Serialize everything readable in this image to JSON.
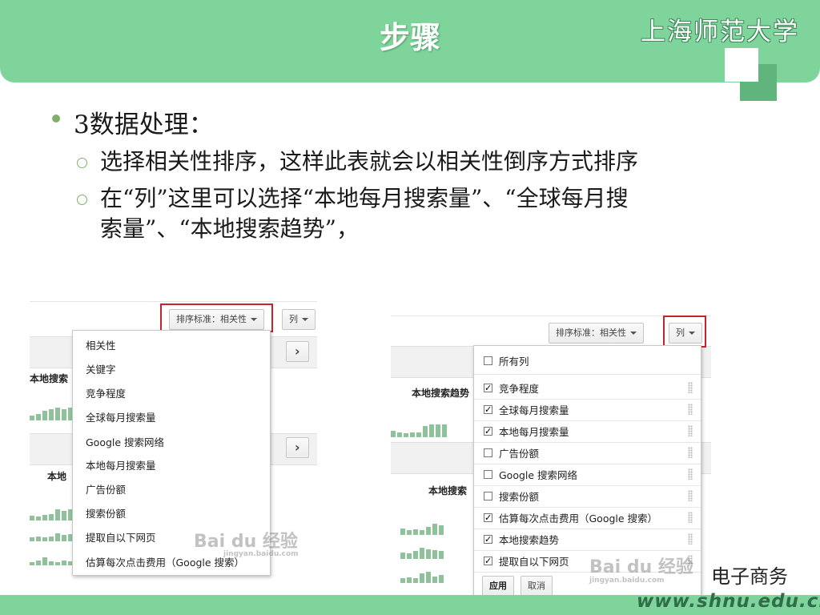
{
  "header": {
    "title": "步骤",
    "university": "上海师范大学"
  },
  "bullets": {
    "main": "3数据处理：",
    "sub1": "选择相关性排序，这样此表就会以相关性倒序方式排序",
    "sub2_line1": "在“列”这里可以选择“本地每月搜索量”、“全球每月搜",
    "sub2_line2": "索量”、“本地搜索趋势”，"
  },
  "shot_left": {
    "sort_button": "排序标准：相关性",
    "columns_button": "列",
    "next_arrow": "›",
    "label_1": "本地搜索",
    "label_2": "本地",
    "menu_items": [
      "相关性",
      "关键字",
      "竞争程度",
      "全球每月搜索量",
      "Google 搜索网络",
      "本地每月搜索量",
      "广告份额",
      "搜索份额",
      "提取自以下网页",
      "估算每次点击费用（Google 搜索）"
    ],
    "watermark": "Bai du 经验",
    "watermark_url": "jingyan.baidu.com"
  },
  "shot_right": {
    "sort_button": "排序标准：相关性",
    "columns_button": "列",
    "label_1": "本地搜索趋势",
    "label_2": "本地搜索",
    "all_columns": "所有列",
    "columns": [
      {
        "label": "竞争程度",
        "checked": true
      },
      {
        "label": "全球每月搜索量",
        "checked": true
      },
      {
        "label": "本地每月搜索量",
        "checked": true
      },
      {
        "label": "广告份额",
        "checked": false
      },
      {
        "label": "Google 搜索网络",
        "checked": false
      },
      {
        "label": "搜索份额",
        "checked": false
      },
      {
        "label": "估算每次点击费用（Google 搜索）",
        "checked": true
      },
      {
        "label": "本地搜索趋势",
        "checked": true
      },
      {
        "label": "提取自以下网页",
        "checked": true
      }
    ],
    "apply_button": "应用",
    "cancel_button": "取消",
    "watermark": "Bai du 经验",
    "watermark_url": "jingyan.baidu.com"
  },
  "footer": {
    "course": "电子商务",
    "url": "www.shnu.edu.cn"
  },
  "colors": {
    "theme_green": "#7fd49b",
    "highlight_red": "#c8232c"
  }
}
